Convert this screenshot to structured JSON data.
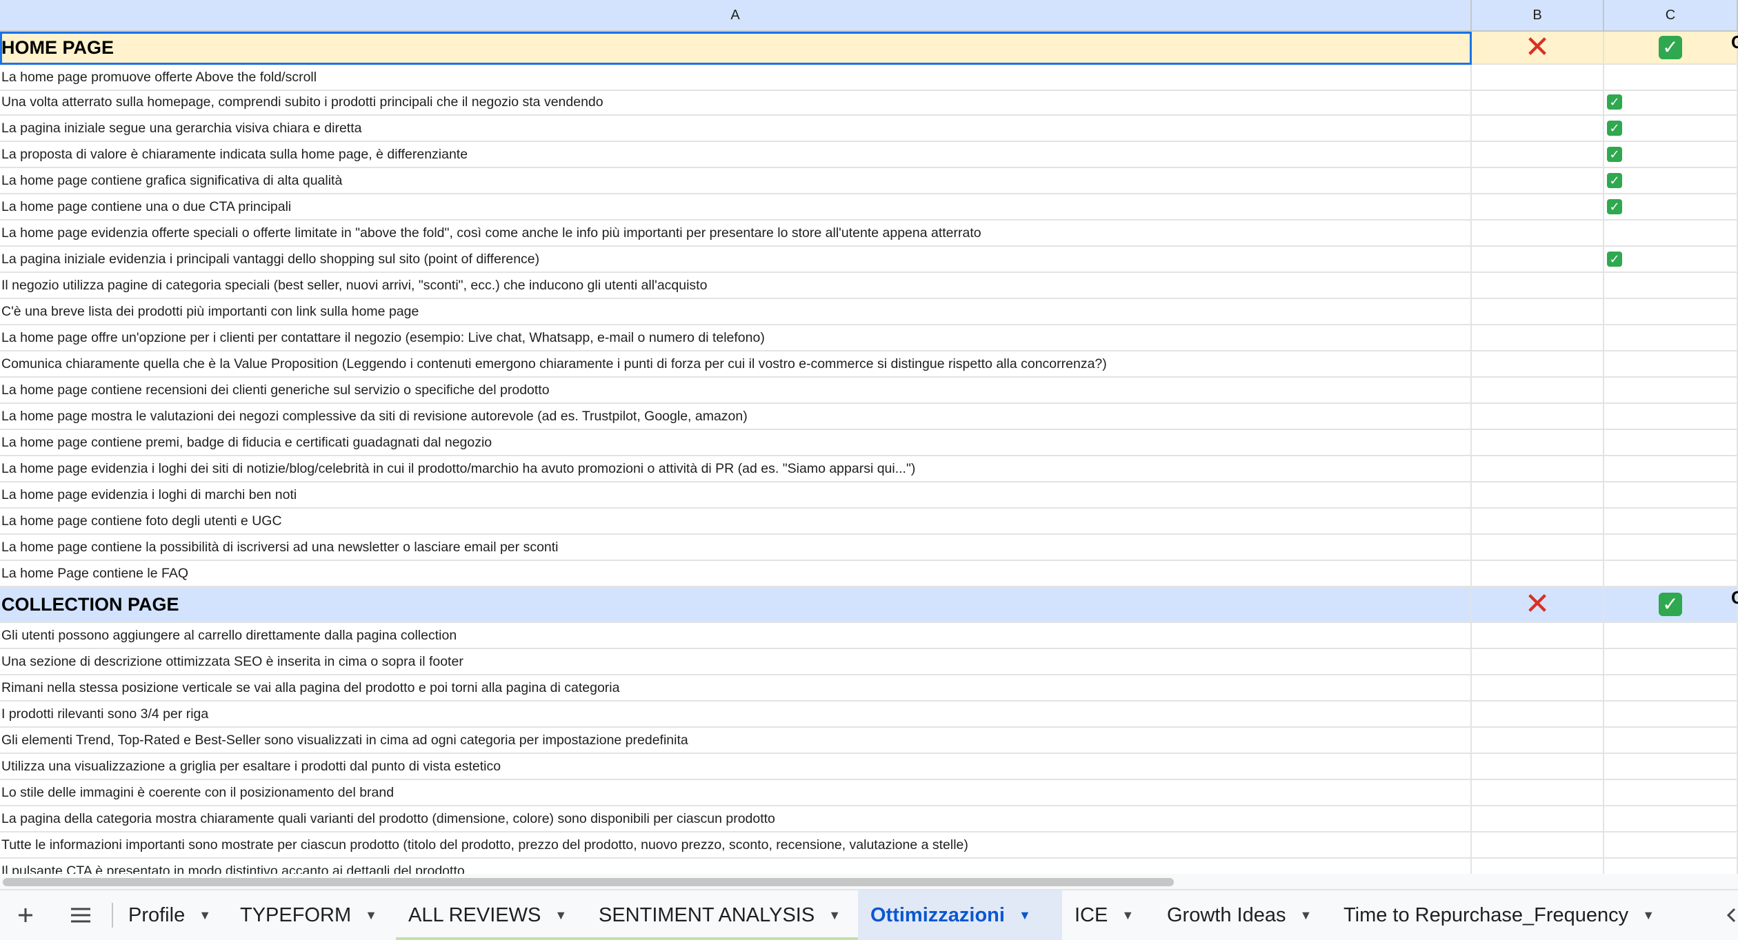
{
  "columns": {
    "a": "A",
    "b": "B",
    "c": "C",
    "d": "C"
  },
  "sections": {
    "home": {
      "title": "HOME PAGE",
      "b_mark": "❌",
      "c_mark": "✅"
    },
    "collection": {
      "title": "COLLECTION PAGE",
      "b_mark": "❌",
      "c_mark": "✅"
    }
  },
  "home_rows": [
    {
      "text": "La home page promuove offerte Above the fold/scroll",
      "c_check": false
    },
    {
      "text": "Una volta atterrato sulla homepage, comprendi subito i prodotti principali che il negozio sta vendendo",
      "c_check": true
    },
    {
      "text": "La pagina iniziale segue una gerarchia visiva chiara e diretta",
      "c_check": true
    },
    {
      "text": "La proposta di valore è chiaramente indicata sulla home page, è differenziante",
      "c_check": true
    },
    {
      "text": "La home page contiene grafica significativa di alta qualità",
      "c_check": true
    },
    {
      "text": "La home page contiene una o due CTA principali",
      "c_check": true
    },
    {
      "text": "La home page evidenzia offerte speciali o offerte limitate in \"above the fold\", così come anche le info più importanti per presentare lo store all'utente appena atterrato",
      "c_check": false
    },
    {
      "text": "La pagina iniziale evidenzia i principali vantaggi dello shopping sul sito (point of difference)",
      "c_check": true
    },
    {
      "text": "Il negozio utilizza pagine di categoria speciali (best seller, nuovi arrivi, \"sconti\", ecc.) che inducono gli utenti all'acquisto",
      "c_check": false
    },
    {
      "text": "C'è una breve lista dei prodotti più importanti con link sulla home page",
      "c_check": false
    },
    {
      "text": "La home page offre un'opzione per i clienti per contattare il negozio (esempio: Live chat, Whatsapp, e-mail o numero di telefono)",
      "c_check": false
    },
    {
      "text": "Comunica chiaramente quella che è la Value Proposition (Leggendo i contenuti emergono chiaramente i punti di forza per cui il vostro e-commerce si distingue rispetto alla concorrenza?)",
      "c_check": false
    },
    {
      "text": "La home page contiene recensioni dei clienti generiche sul servizio o specifiche del prodotto",
      "c_check": false
    },
    {
      "text": "La home page mostra le valutazioni dei negozi complessive da siti di revisione autorevole (ad es. Trustpilot, Google, amazon)",
      "c_check": false
    },
    {
      "text": "La home page contiene premi, badge di fiducia e certificati guadagnati dal negozio",
      "c_check": false
    },
    {
      "text": "La home page evidenzia i loghi dei siti di notizie/blog/celebrità in cui il prodotto/marchio ha avuto promozioni o attività di PR (ad es. \"Siamo apparsi qui...\")",
      "c_check": false
    },
    {
      "text": "La home page evidenzia i loghi di marchi ben noti",
      "c_check": false
    },
    {
      "text": "La home page contiene foto degli utenti e UGC",
      "c_check": false
    },
    {
      "text": "La home page contiene la possibilità di iscriversi ad una newsletter o lasciare email per sconti",
      "c_check": false
    },
    {
      "text": "La home Page contiene le FAQ",
      "c_check": false
    }
  ],
  "collection_rows": [
    {
      "text": "Gli utenti possono aggiungere al carrello direttamente dalla pagina collection"
    },
    {
      "text": "Una sezione di descrizione ottimizzata SEO è inserita in cima o sopra il footer"
    },
    {
      "text": "Rimani nella stessa posizione verticale se vai alla pagina del prodotto e poi torni alla pagina di categoria"
    },
    {
      "text": "I prodotti rilevanti sono 3/4 per riga"
    },
    {
      "text": "Gli elementi Trend, Top-Rated e Best-Seller sono visualizzati in cima ad ogni categoria per impostazione predefinita"
    },
    {
      "text": "Utilizza una visualizzazione a griglia per esaltare i prodotti dal punto di vista estetico"
    },
    {
      "text": "Lo stile delle immagini è coerente con il posizionamento del brand"
    },
    {
      "text": "La pagina della categoria mostra chiaramente quali varianti del prodotto (dimensione, colore) sono disponibili per ciascun prodotto"
    },
    {
      "text": "Tutte le informazioni importanti sono mostrate per ciascun prodotto (titolo del prodotto, prezzo del prodotto, nuovo prezzo, sconto, recensione, valutazione a stelle)"
    },
    {
      "text": "Il pulsante CTA è presentato in modo distintivo accanto ai dettagli del prodotto"
    }
  ],
  "tabs": [
    {
      "label": "Profile",
      "active": false,
      "underline": ""
    },
    {
      "label": "TYPEFORM",
      "active": false,
      "underline": ""
    },
    {
      "label": "ALL REVIEWS",
      "active": false,
      "underline": "#c5e1a5"
    },
    {
      "label": "SENTIMENT ANALYSIS",
      "active": false,
      "underline": "#c5e1a5"
    },
    {
      "label": "Ottimizzazioni",
      "active": true,
      "underline": ""
    },
    {
      "label": "ICE",
      "active": false,
      "underline": ""
    },
    {
      "label": "Growth Ideas",
      "active": false,
      "underline": ""
    },
    {
      "label": "Time to Repurchase_Frequency",
      "active": false,
      "underline": ""
    }
  ],
  "icons": {
    "add": "plus-icon",
    "menu": "hamburger-icon",
    "prev": "chevron-left-icon"
  },
  "colors": {
    "home_section_bg": "#fff2cc",
    "collection_section_bg": "#d3e3fd",
    "header_bg": "#d3e3fd",
    "check_green": "#2fa84f",
    "cross_red": "#d93025",
    "active_tab": "#0b57d0"
  }
}
